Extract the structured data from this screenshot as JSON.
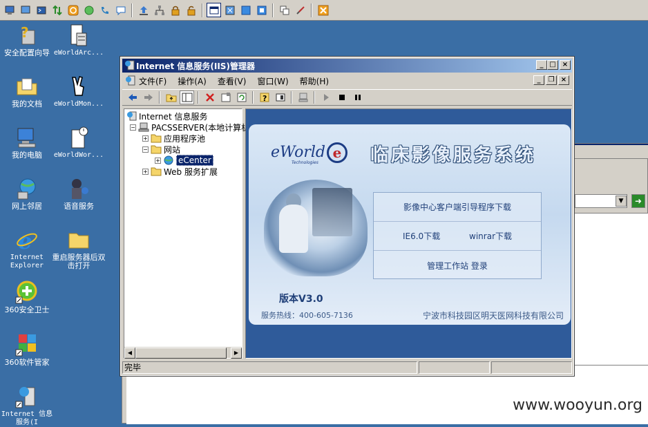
{
  "desktop": {
    "icons": [
      {
        "label": "安全配置向导",
        "mono": false
      },
      {
        "label": "eWorldArc...",
        "mono": true
      },
      {
        "label": "我的文档",
        "mono": false
      },
      {
        "label": "eWorldMon...",
        "mono": true
      },
      {
        "label": "我的电脑",
        "mono": false
      },
      {
        "label": "eWorldWor...",
        "mono": true
      },
      {
        "label": "网上邻居",
        "mono": false
      },
      {
        "label": "语音服务",
        "mono": false
      },
      {
        "label": "Internet\nExplorer",
        "mono": true
      },
      {
        "label": "重启服务器后双击打开",
        "mono": false
      },
      {
        "label": "360安全卫士",
        "mono": false
      },
      {
        "label": "360软件管家",
        "mono": false
      },
      {
        "label": "Internet 信息服务(I",
        "mono": true
      }
    ]
  },
  "window": {
    "title": "Internet 信息服务(IIS)管理器",
    "menu": [
      "文件(F)",
      "操作(A)",
      "查看(V)",
      "窗口(W)",
      "帮助(H)"
    ],
    "tree": {
      "root": "Internet 信息服务",
      "server": "PACSSERVER(本地计算机",
      "app_pools": "应用程序池",
      "websites": "网站",
      "ecenter": "eCenter",
      "web_ext": "Web 服务扩展"
    },
    "status": "完毕"
  },
  "banner": {
    "logo_text": "eWorld",
    "logo_sub": "Technologies",
    "system_title": "临床影像服务系统",
    "link_client": "影像中心客户端引导程序下载",
    "link_ie": "IE6.0下载",
    "link_winrar": "winrar下载",
    "link_manage": "管理工作站 登录",
    "version": "版本V3.0",
    "hotline": "服务热线：400-605-7136",
    "company": "宁波市科技园区明天医网科技有限公司"
  },
  "watermark": "www.wooyun.org"
}
